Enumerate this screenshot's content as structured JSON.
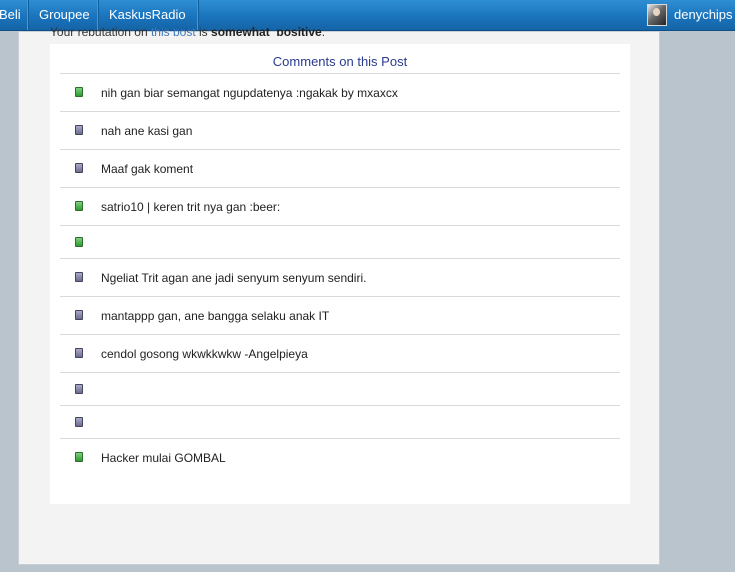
{
  "topbar": {
    "items": [
      "Beli",
      "Groupee",
      "KaskusRadio"
    ],
    "username": "denychips"
  },
  "reputation": {
    "prefix": "Your reputation on ",
    "link": "this post",
    "middle": " is ",
    "level": "somewhat_positive",
    "suffix": "."
  },
  "comments": {
    "title": "Comments on this Post",
    "rows": [
      {
        "text": "nih gan biar semangat ngupdatenya :ngakak by mxaxcx",
        "type": "positive"
      },
      {
        "text": "nah ane kasi gan",
        "type": "neutral"
      },
      {
        "text": "Maaf gak koment",
        "type": "neutral"
      },
      {
        "text": "satrio10 | keren trit nya gan :beer:",
        "type": "positive"
      },
      {
        "text": "",
        "type": "positive"
      },
      {
        "text": "Ngeliat Trit agan ane jadi senyum senyum sendiri.",
        "type": "neutral"
      },
      {
        "text": "mantappp gan, ane bangga selaku anak IT",
        "type": "neutral"
      },
      {
        "text": "cendol gosong wkwkkwkw -Angelpieya",
        "type": "neutral"
      },
      {
        "text": "",
        "type": "neutral"
      },
      {
        "text": "",
        "type": "neutral"
      },
      {
        "text": "Hacker mulai GOMBAL",
        "type": "positive"
      }
    ]
  },
  "colors": {
    "positive_icon": "#3fa83f",
    "neutral_icon": "#7a7a9a",
    "link": "#3d79b8",
    "header_text": "#2b3a8f"
  }
}
